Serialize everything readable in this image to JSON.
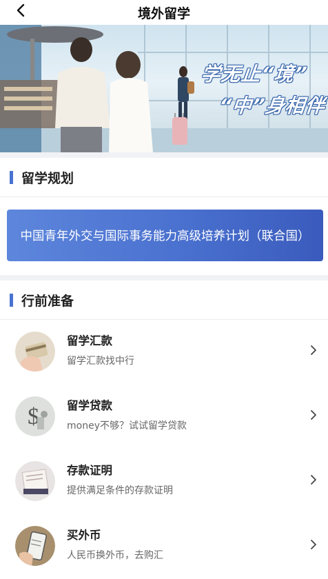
{
  "header": {
    "title": "境外留学",
    "back_icon": "chevron-left-icon"
  },
  "banner": {
    "slogan_line1": "学无止“境”",
    "slogan_line2": "“中”身相伴"
  },
  "sections": {
    "planning": {
      "title": "留学规划",
      "program_label": "中国青年外交与国际事务能力高级培养计划（联合国）"
    },
    "preparation": {
      "title": "行前准备"
    }
  },
  "items": [
    {
      "title": "留学汇款",
      "subtitle": "留学汇款找中行",
      "icon": "card-payment-icon"
    },
    {
      "title": "留学贷款",
      "subtitle": "money不够？试试留学贷款",
      "icon": "dollar-sign-icon"
    },
    {
      "title": "存款证明",
      "subtitle": "提供满足条件的存款证明",
      "icon": "document-icon"
    },
    {
      "title": "买外币",
      "subtitle": "人民币换外币，去购汇",
      "icon": "phone-exchange-icon"
    }
  ],
  "colors": {
    "accent": "#4a72d0",
    "button_gradient_start": "#5d86dc",
    "button_gradient_end": "#3a5bbd"
  }
}
